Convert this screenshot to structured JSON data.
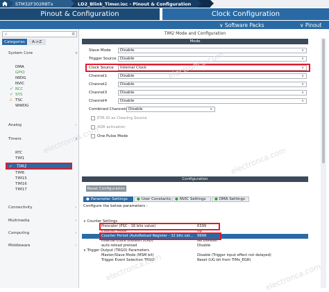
{
  "breadcrumb": {
    "home_icon": "home-icon",
    "items": [
      "STM32F302R8Tx",
      "LD2_Blink_Timer.ioc - Pinout & Configuration",
      ""
    ]
  },
  "tabs": {
    "pinout": "Pinout & Configuration",
    "clock": "Clock Configuration"
  },
  "subbar": {
    "software_packs": "∨ Software Packs",
    "pinout": "∨ Pinout"
  },
  "sidebar": {
    "search_placeholder": "",
    "category_tabs": [
      "Categories",
      "A->Z"
    ],
    "system_core": {
      "label": "System Core",
      "items": [
        {
          "label": "DMA",
          "status": ""
        },
        {
          "label": "GPIO",
          "status": ""
        },
        {
          "label": "IWDG",
          "status": ""
        },
        {
          "label": "NVIC",
          "status": ""
        },
        {
          "label": "RCC",
          "status": "check"
        },
        {
          "label": "SYS",
          "status": "check"
        },
        {
          "label": "TSC",
          "status": "warning"
        },
        {
          "label": "WWDG",
          "status": ""
        }
      ]
    },
    "analog": "Analog",
    "timers": {
      "label": "Timers",
      "items": [
        "RTC",
        "TIM1",
        "TIM2",
        "TIM6",
        "TIM15",
        "TIM16",
        "TIM17"
      ],
      "selected": "TIM2"
    },
    "connectivity": "Connectivity",
    "multimedia": "Multimedia",
    "computing": "Computing",
    "middleware": "Middleware"
  },
  "mode": {
    "title": "TIM2 Mode and Configuration",
    "header": "Mode",
    "fields": [
      {
        "label": "Slave Mode",
        "value": "Disable"
      },
      {
        "label": "Trigger Source",
        "value": "Disable"
      },
      {
        "label": "Clock Source",
        "value": "Internal Clock"
      },
      {
        "label": "Channel1",
        "value": "Disable"
      },
      {
        "label": "Channel2",
        "value": "Disable"
      },
      {
        "label": "Channel3",
        "value": "Disable"
      },
      {
        "label": "Channel4",
        "value": "Disable"
      },
      {
        "label": "Combined Channels",
        "value": "Disable"
      }
    ],
    "checks": [
      {
        "label": "ETR IO as Clearing Source",
        "enabled": false
      },
      {
        "label": "XOR activation",
        "enabled": false
      },
      {
        "label": "One Pulse Mode",
        "enabled": true
      }
    ]
  },
  "configuration": {
    "header": "Configuration",
    "reset_label": "Reset Configuration",
    "tabs": [
      "Parameter Settings",
      "User Constants",
      "NVIC Settings",
      "DMA Settings"
    ],
    "hint": "Configure the below parameters :",
    "rows": [
      {
        "key": "∨  Counter Settings",
        "value": "",
        "indent": 0
      },
      {
        "key": "Prescaler (PSC - 16 bits value)",
        "value": "6399",
        "indent": 1
      },
      {
        "key": "Counter Mode",
        "value": "Up",
        "indent": 1
      },
      {
        "key": "Counter Period (AutoReload Register - 32 bits val...",
        "value": "9999",
        "indent": 1
      },
      {
        "key": "Internal Clock Division (CKD)",
        "value": "No Division",
        "indent": 1
      },
      {
        "key": "auto-reload preload",
        "value": "Disable",
        "indent": 1
      },
      {
        "key": "∨  Trigger Output (TRGO) Parameters",
        "value": "",
        "indent": 0
      },
      {
        "key": "Master/Slave Mode (MSM bit)",
        "value": "Disable (Trigger input effect not delayed)",
        "indent": 1
      },
      {
        "key": "Trigger Event Selection TRGO",
        "value": "Reset (UG bit from TIMx_EGR)",
        "indent": 1
      }
    ]
  },
  "watermark": "electronca.com",
  "colors": {
    "primary": "#1c4a74",
    "accent": "#2a6aa4",
    "highlight": "#e0192c"
  }
}
